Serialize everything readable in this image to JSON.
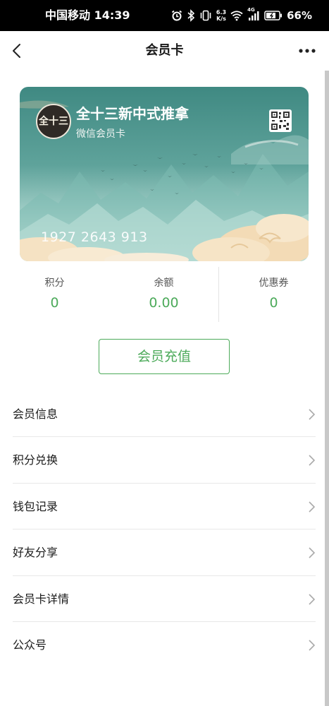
{
  "status_bar": {
    "carrier_time": "中国移动 14:39",
    "net_speed_value": "6.3",
    "net_speed_unit": "K/s",
    "signal_type": "4G",
    "battery": "66%"
  },
  "navbar": {
    "title": "会员卡"
  },
  "card": {
    "logo_text": "全十三",
    "name": "全十三新中式推拿",
    "type": "微信会员卡",
    "number": "1927 2643 913"
  },
  "stats": [
    {
      "label": "积分",
      "value": "0"
    },
    {
      "label": "余额",
      "value": "0.00"
    },
    {
      "label": "优惠券",
      "value": "0"
    }
  ],
  "recharge_label": "会员充值",
  "menu": [
    {
      "label": "会员信息"
    },
    {
      "label": "积分兑换"
    },
    {
      "label": "钱包记录"
    },
    {
      "label": "好友分享"
    },
    {
      "label": "会员卡详情"
    },
    {
      "label": "公众号"
    }
  ],
  "colors": {
    "accent": "#4caa5a",
    "card_teal": "#3e8a84",
    "status_bar": "#000000"
  }
}
